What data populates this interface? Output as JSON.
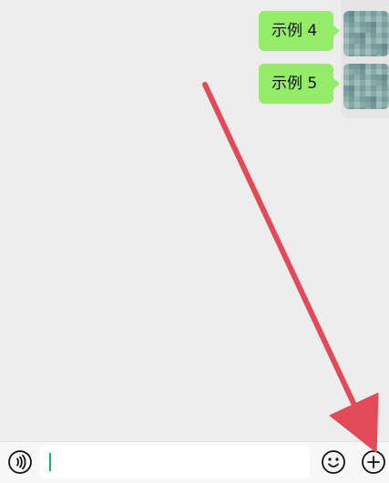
{
  "chat": {
    "messages": [
      {
        "text": "示例 4"
      },
      {
        "text": "示例 5"
      }
    ]
  },
  "input": {
    "value": ""
  },
  "icons": {
    "voice": "voice-icon",
    "emoji": "emoji-icon",
    "plus": "plus-icon"
  },
  "colors": {
    "bubble": "#95ec69",
    "arrow": "#e24a58",
    "cursor": "#07c160"
  }
}
